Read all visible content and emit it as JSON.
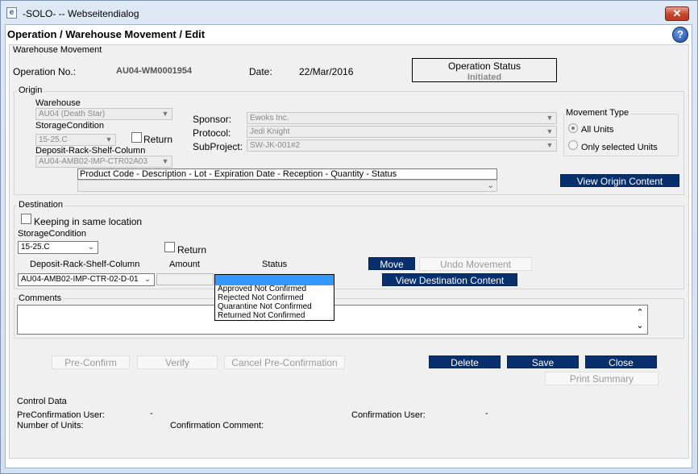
{
  "window": {
    "title": "-SOLO- -- Webseitendialog",
    "close_label": "✕",
    "app_icon": "ie-icon"
  },
  "page": {
    "title": "Operation / Warehouse Movement / Edit",
    "help_label": "?"
  },
  "tab_label": "Warehouse Movement",
  "header": {
    "operation_no_label": "Operation No.:",
    "operation_no": "AU04-WM0001954",
    "date_label": "Date:",
    "date": "22/Mar/2016",
    "status_title": "Operation Status",
    "status_value": "Initiated"
  },
  "origin": {
    "legend": "Origin",
    "warehouse_label": "Warehouse",
    "warehouse_value": "AU04 (Death Star)",
    "storage_condition_label": "StorageCondition",
    "storage_condition_value": "15-25.C",
    "return_label": "Return",
    "location_label": "Deposit-Rack-Shelf-Column",
    "location_value": "AU04-AMB02-IMP-CTR02A03",
    "sponsor_label": "Sponsor:",
    "sponsor_value": "Ewoks Inc.",
    "protocol_label": "Protocol:",
    "protocol_value": "Jedi Knight",
    "subproject_label": "SubProject:",
    "subproject_value": "SW-JK-001#2",
    "movement_type_legend": "Movement Type",
    "movement_all_units": "All Units",
    "movement_selected_units": "Only selected Units",
    "product_header": "Product Code - Description - Lot - Expiration Date - Reception - Quantity - Status",
    "view_origin_button": "View Origin Content"
  },
  "destination": {
    "legend": "Destination",
    "keep_same_location_label": "Keeping in same location",
    "storage_condition_label": "StorageCondition",
    "storage_condition_value": "15-25.C",
    "return_label": "Return",
    "location_label": "Deposit-Rack-Shelf-Column",
    "amount_label": "Amount",
    "status_label": "Status",
    "location_value": "AU04-AMB02-IMP-CTR-02-D-01",
    "move_button": "Move",
    "undo_button": "Undo Movement",
    "view_destination_button": "View Destination Content",
    "status_options": [
      "Approved Not Confirmed",
      "Rejected Not Confirmed",
      "Quarantine Not Confirmed",
      "Returned Not Confirmed"
    ]
  },
  "comments": {
    "label": "Comments"
  },
  "actions": {
    "pre_confirm": "Pre-Confirm",
    "verify": "Verify",
    "cancel_pre_confirmation": "Cancel Pre-Confirmation",
    "delete": "Delete",
    "save": "Save",
    "close": "Close",
    "print_summary": "Print Summary"
  },
  "control_data": {
    "legend": "Control Data",
    "preconfirmation_user_label": "PreConfirmation User:",
    "preconfirmation_user_value": "-",
    "confirmation_user_label": "Confirmation User:",
    "confirmation_user_value": "-",
    "number_of_units_label": "Number of Units:",
    "confirmation_comment_label": "Confirmation Comment:"
  },
  "colors": {
    "button_blue": "#09306e",
    "dropdown_highlight": "#3399ff"
  }
}
